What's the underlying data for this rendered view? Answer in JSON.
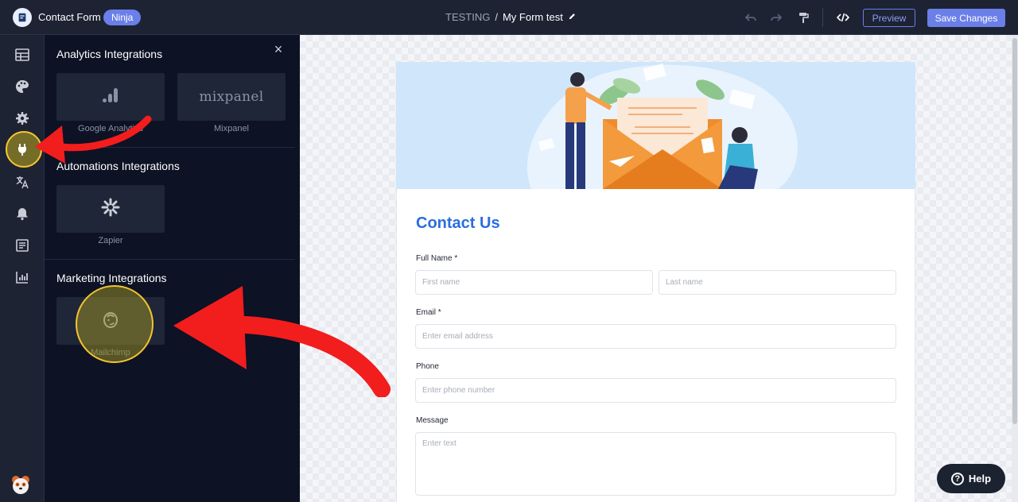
{
  "app": {
    "title": "Contact Form",
    "badge": "Ninja"
  },
  "breadcrumb": {
    "root": "TESTING",
    "separator": "/",
    "form_name": "My Form test"
  },
  "toolbar": {
    "preview_label": "Preview",
    "save_label": "Save Changes",
    "icons": [
      "undo-icon",
      "redo-icon",
      "paint-roller-icon",
      "code-icon"
    ]
  },
  "rail": {
    "icons": [
      "table-icon",
      "palette-icon",
      "gear-icon",
      "plug-icon",
      "translate-icon",
      "bell-icon",
      "form-icon",
      "chart-icon"
    ],
    "active": "plug-icon"
  },
  "panel": {
    "close_label": "×",
    "sections": [
      {
        "title": "Analytics Integrations",
        "cards": [
          {
            "label": "Google Analytics",
            "icon": "google-analytics-icon"
          },
          {
            "label": "Mixpanel",
            "logo_text": "mixpanel"
          }
        ]
      },
      {
        "title": "Automations Integrations",
        "cards": [
          {
            "label": "Zapier",
            "icon": "zapier-icon"
          }
        ]
      },
      {
        "title": "Marketing Integrations",
        "cards": [
          {
            "label": "Mailchimp",
            "icon": "mailchimp-icon"
          }
        ]
      }
    ]
  },
  "form": {
    "heading": "Contact Us",
    "full_name_label": "Full Name *",
    "first_name_placeholder": "First name",
    "last_name_placeholder": "Last name",
    "email_label": "Email *",
    "email_placeholder": "Enter email address",
    "phone_label": "Phone",
    "phone_placeholder": "Enter phone number",
    "message_label": "Message",
    "message_placeholder": "Enter text"
  },
  "help": {
    "label": "Help",
    "icon_glyph": "?"
  },
  "colors": {
    "topbar": "#1d2333",
    "panel": "#0d1224",
    "accent": "#6b7fe8",
    "heading_blue": "#2a6de0",
    "annotation_red": "#f21d1d",
    "highlight_yellow": "#f4c430"
  }
}
